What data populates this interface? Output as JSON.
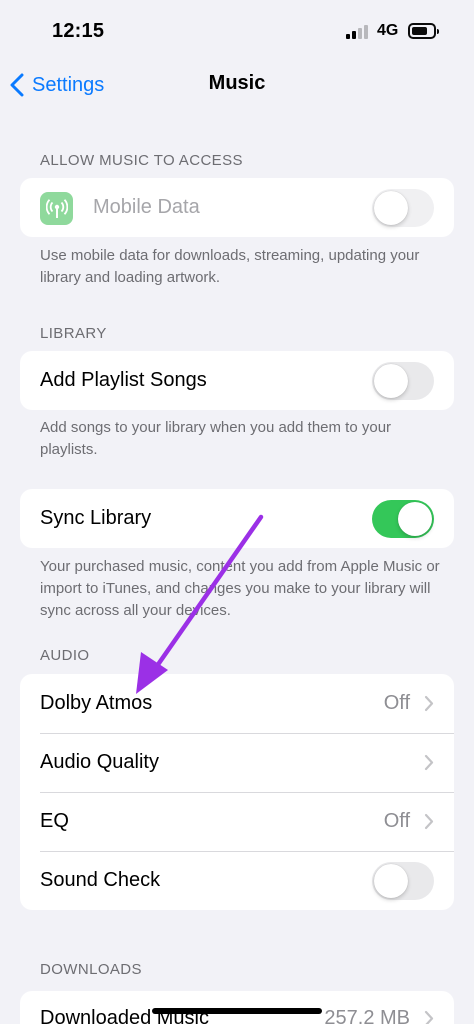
{
  "status_bar": {
    "time": "12:15",
    "network": "4G"
  },
  "nav": {
    "back_label": "Settings",
    "title": "Music"
  },
  "sections": {
    "access": {
      "header": "ALLOW MUSIC TO ACCESS",
      "mobile_data": {
        "label": "Mobile Data",
        "enabled": false,
        "disabled": true
      },
      "footer": "Use mobile data for downloads, streaming, updating your library and loading artwork."
    },
    "library": {
      "header": "LIBRARY",
      "add_playlist_songs": {
        "label": "Add Playlist Songs",
        "enabled": false
      },
      "add_playlist_footer": "Add songs to your library when you add them to your playlists.",
      "sync_library": {
        "label": "Sync Library",
        "enabled": true
      },
      "sync_footer": "Your purchased music, content you add from Apple Music or import to iTunes, and changes you make to your library will sync across all your devices."
    },
    "audio": {
      "header": "AUDIO",
      "dolby_atmos": {
        "label": "Dolby Atmos",
        "value": "Off"
      },
      "audio_quality": {
        "label": "Audio Quality"
      },
      "eq": {
        "label": "EQ",
        "value": "Off"
      },
      "sound_check": {
        "label": "Sound Check",
        "enabled": false
      }
    },
    "downloads": {
      "header": "DOWNLOADS",
      "downloaded_music": {
        "label": "Downloaded Music",
        "value": "257.2 MB"
      }
    }
  },
  "colors": {
    "accent": "#0a7aff",
    "toggle_on": "#34c759",
    "annotation_arrow": "#9b30e6",
    "background": "#f2f2f7"
  },
  "icons": {
    "back": "chevron-left-icon",
    "mobile_data": "antenna-icon",
    "disclosure": "chevron-right-icon"
  }
}
